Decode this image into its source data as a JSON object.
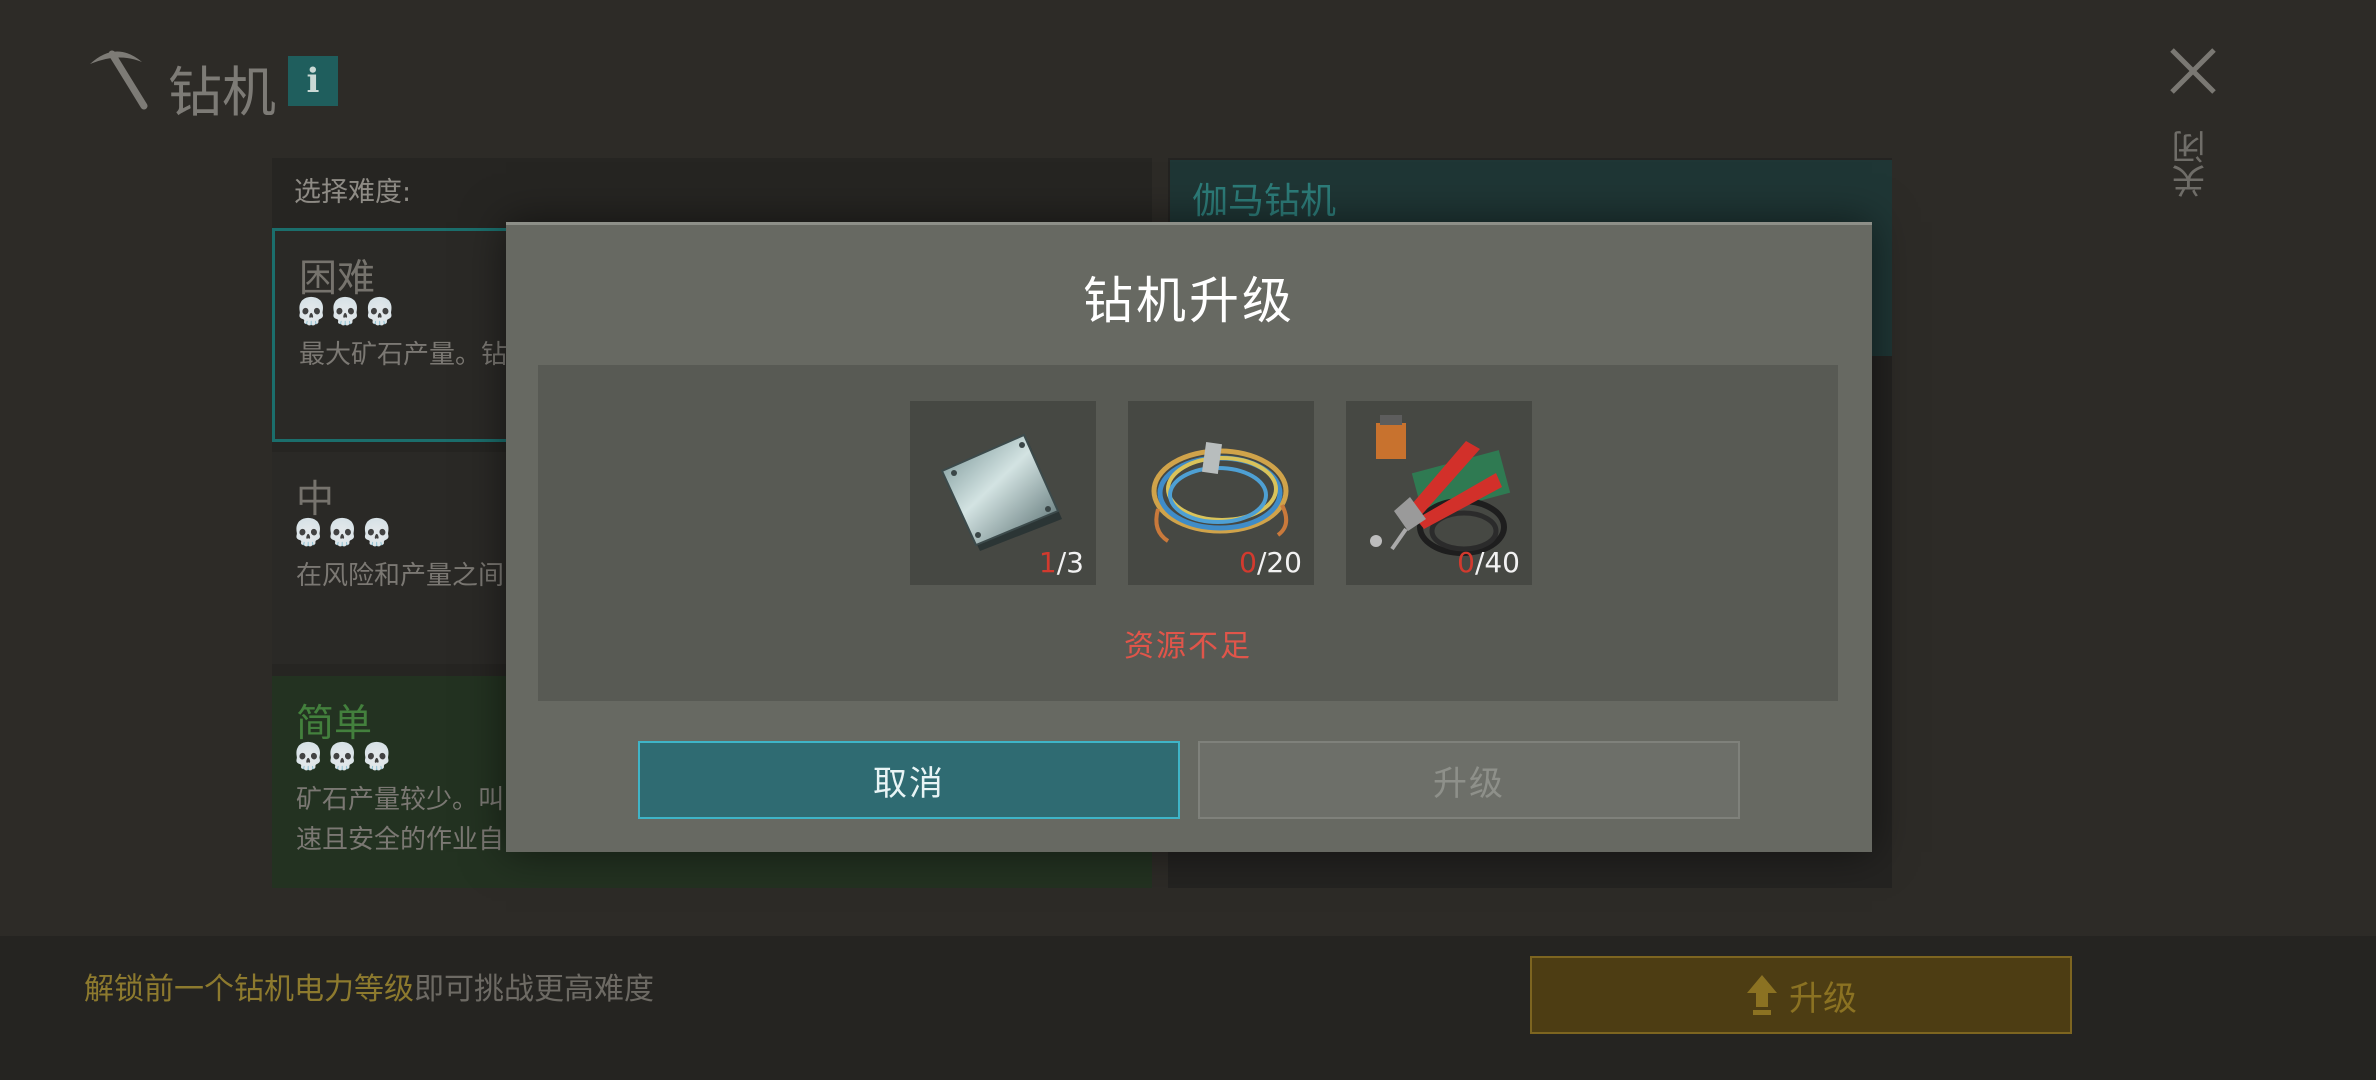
{
  "header": {
    "title": "钻机",
    "info_icon": "i"
  },
  "close": {
    "label": "关闭"
  },
  "difficulty": {
    "label": "选择难度:",
    "cards": [
      {
        "name": "困难",
        "skulls": "💀💀💀",
        "desc": "最大矿石产量。钻"
      },
      {
        "name": "中",
        "skulls": "💀💀💀",
        "desc": "在风险和产量之间"
      },
      {
        "name": "简单",
        "skulls": "💀💀💀",
        "desc_line1": "矿石产量较少。叫",
        "desc_line2": "速且安全的作业自"
      }
    ]
  },
  "drill": {
    "name": "伽马钻机"
  },
  "footer": {
    "hint_highlight": "解锁前一个钻机电力等级",
    "hint_rest": "即可挑战更高难度",
    "upgrade_label": "升级"
  },
  "modal": {
    "title": "钻机升级",
    "resources": [
      {
        "icon": "metal-plate-icon",
        "have": "1",
        "need": "/3"
      },
      {
        "icon": "wire-coil-icon",
        "have": "0",
        "need": "/20"
      },
      {
        "icon": "electrical-parts-icon",
        "have": "0",
        "need": "/40"
      }
    ],
    "warning": "资源不足",
    "cancel_label": "取消",
    "upgrade_label": "升级"
  },
  "colors": {
    "accent_teal": "#3fb4c7",
    "warning_red": "#e0554a",
    "gold": "#8d7a2e"
  }
}
